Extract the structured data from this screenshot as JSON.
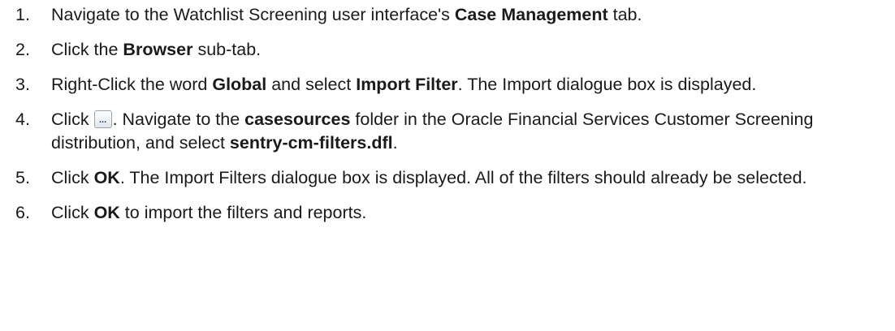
{
  "steps": [
    {
      "num": "1.",
      "parts": [
        "Navigate to the Watchlist Screening user interface's ",
        "Case Management",
        " tab."
      ]
    },
    {
      "num": "2.",
      "parts": [
        "Click the ",
        "Browser",
        " sub-tab."
      ]
    },
    {
      "num": "3.",
      "parts": [
        "Right-Click the word ",
        "Global",
        " and select ",
        "Import Filter",
        ". The Import dialogue box is displayed."
      ]
    },
    {
      "num": "4.",
      "parts": [
        "Click",
        ". Navigate to the ",
        "casesources",
        " folder in the Oracle Financial Services Customer Screening distribution, and select ",
        "sentry-cm-filters.dfl",
        "."
      ],
      "button_glyph": "..."
    },
    {
      "num": "5.",
      "parts": [
        "Click ",
        "OK",
        ". The Import Filters dialogue box is displayed. All of the filters should already be selected."
      ]
    },
    {
      "num": "6.",
      "parts": [
        "Click ",
        "OK",
        " to import the filters and reports."
      ]
    }
  ]
}
